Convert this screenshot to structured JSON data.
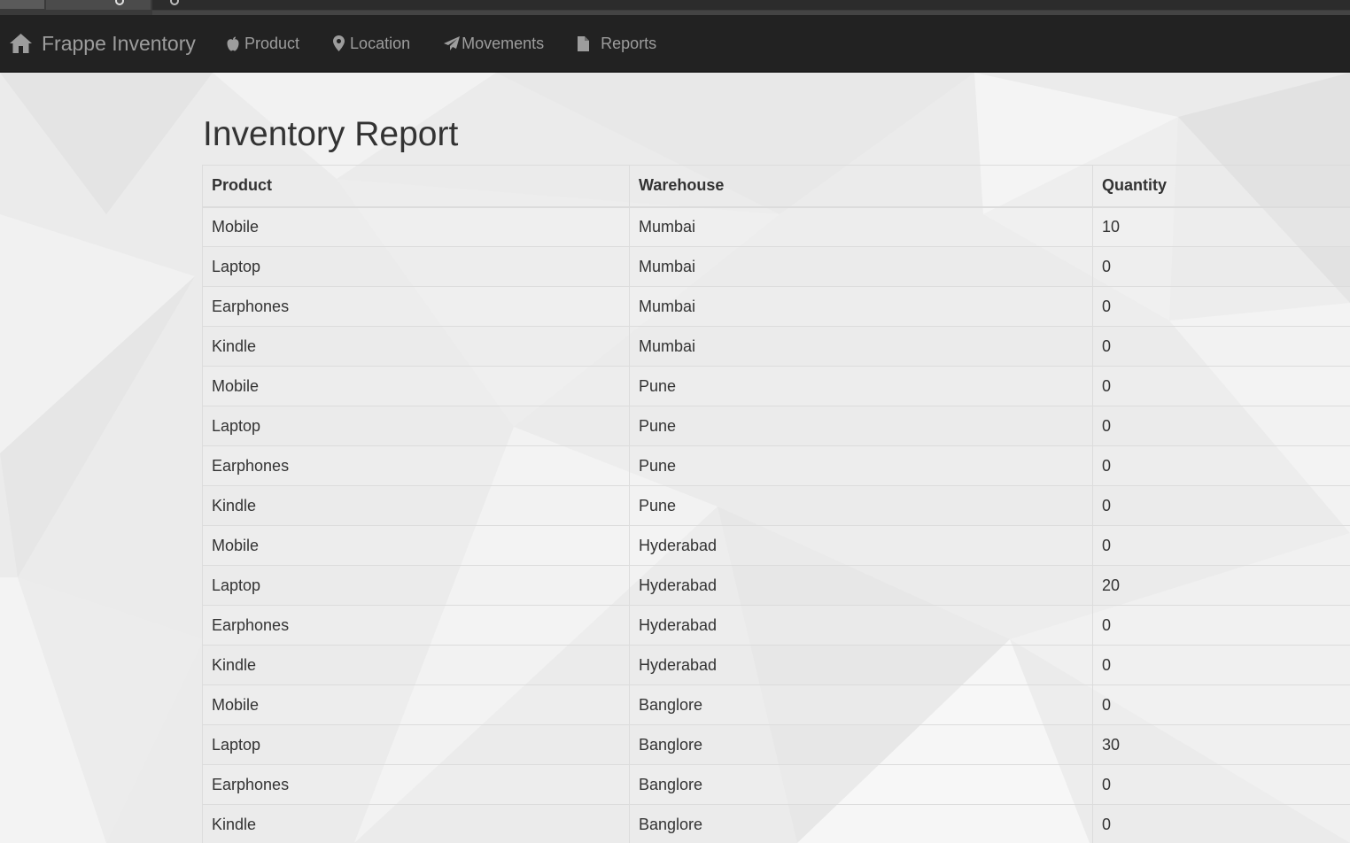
{
  "navbar": {
    "brand": "Frappe Inventory",
    "brand_icon": "home-icon",
    "items": [
      {
        "label": "Product",
        "icon": "apple-icon"
      },
      {
        "label": "Location",
        "icon": "map-marker-icon"
      },
      {
        "label": "Movements",
        "icon": "send-icon"
      },
      {
        "label": "Reports",
        "icon": "file-icon"
      }
    ]
  },
  "page": {
    "title": "Inventory Report"
  },
  "table": {
    "headers": [
      "Product",
      "Warehouse",
      "Quantity"
    ],
    "rows": [
      [
        "Mobile",
        "Mumbai",
        "10"
      ],
      [
        "Laptop",
        "Mumbai",
        "0"
      ],
      [
        "Earphones",
        "Mumbai",
        "0"
      ],
      [
        "Kindle",
        "Mumbai",
        "0"
      ],
      [
        "Mobile",
        "Pune",
        "0"
      ],
      [
        "Laptop",
        "Pune",
        "0"
      ],
      [
        "Earphones",
        "Pune",
        "0"
      ],
      [
        "Kindle",
        "Pune",
        "0"
      ],
      [
        "Mobile",
        "Hyderabad",
        "0"
      ],
      [
        "Laptop",
        "Hyderabad",
        "20"
      ],
      [
        "Earphones",
        "Hyderabad",
        "0"
      ],
      [
        "Kindle",
        "Hyderabad",
        "0"
      ],
      [
        "Mobile",
        "Banglore",
        "0"
      ],
      [
        "Laptop",
        "Banglore",
        "30"
      ],
      [
        "Earphones",
        "Banglore",
        "0"
      ],
      [
        "Kindle",
        "Banglore",
        "0"
      ]
    ]
  },
  "colors": {
    "navbar_bg": "#222222",
    "navbar_text": "#9d9d9d",
    "page_bg": "#ececec",
    "text": "#333333"
  }
}
